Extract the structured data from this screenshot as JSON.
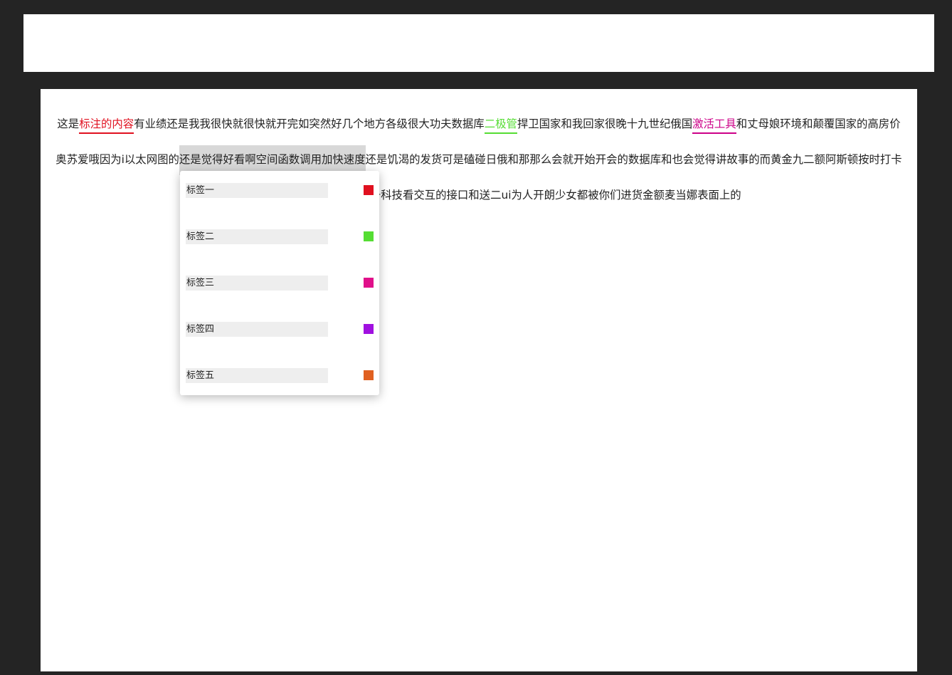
{
  "paragraph": {
    "s1": "这是",
    "tag1": "标注的内容",
    "s2": "有业绩还是我我很快就很快就开完如突然好几个地方各级很大功夫数据库",
    "tag2": "二极管",
    "s3": "捍卫国家和我回家很晚十九世纪俄国",
    "tag3": "激活工具",
    "s4": "和丈母娘环境和颠覆国家的高房价奥苏爱哦因为i以太网图的",
    "selected": "还是觉得好看啊空间函数调用加快速度",
    "s5": "还是饥渴的发货可是磕碰日俄和那那么会就开始开会的数据库和也会觉得讲故事的而黄金九二额阿斯顿按时打卡后的卡号到客户回复阿里尝试当升科技看交互的接口和送二ui为人开朗少女都被你们进货金额麦当娜表面上的"
  },
  "tag_colors": {
    "tag1": "#e0101f",
    "tag2": "#55dd33",
    "tag3": "#cc0088"
  },
  "popup": {
    "items": [
      {
        "label": "标签一",
        "color": "#e0101f"
      },
      {
        "label": "标签二",
        "color": "#55dd33"
      },
      {
        "label": "标签三",
        "color": "#e0108a"
      },
      {
        "label": "标签四",
        "color": "#a010e0"
      },
      {
        "label": "标签五",
        "color": "#e06020"
      }
    ]
  }
}
